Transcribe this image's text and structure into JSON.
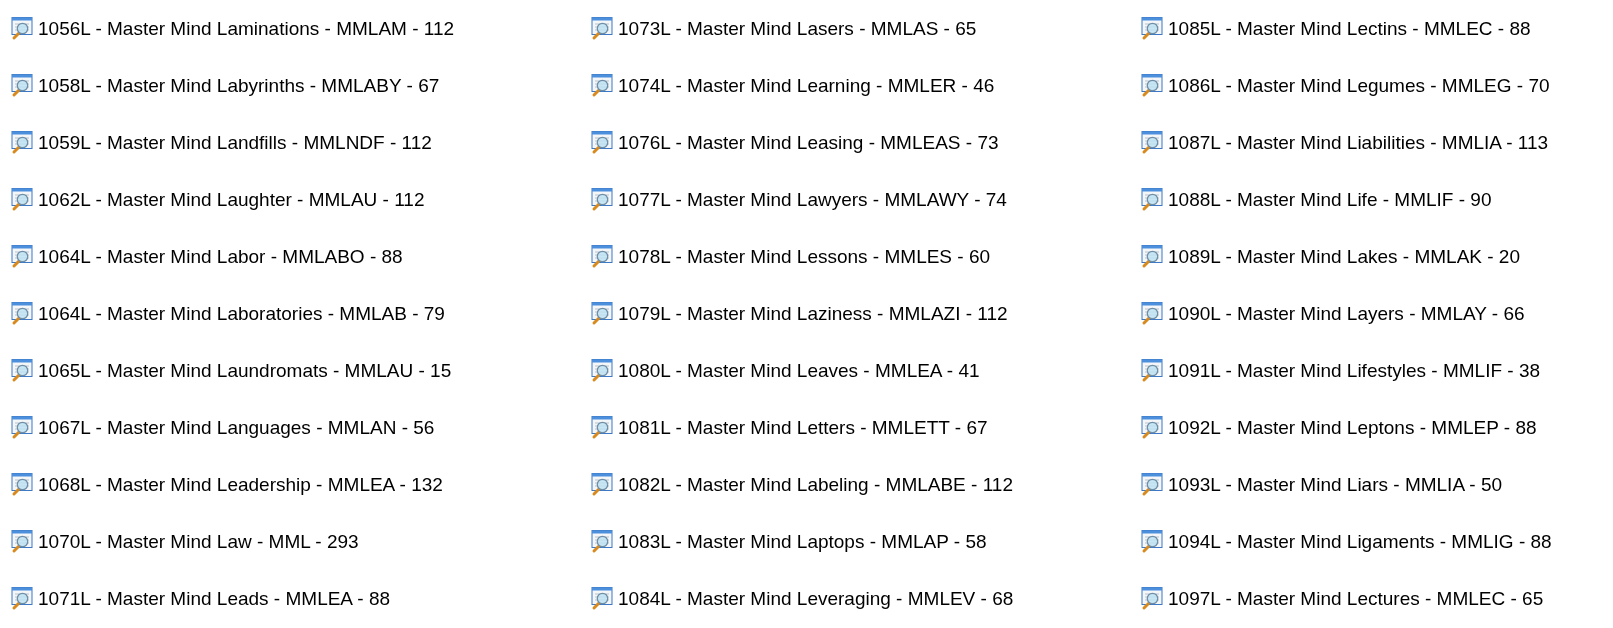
{
  "columns": [
    {
      "files": [
        "1056L - Master Mind Laminations - MMLAM - 112",
        "1058L - Master Mind Labyrinths - MMLABY - 67",
        "1059L - Master Mind Landfills - MMLNDF - 112",
        "1062L - Master Mind Laughter - MMLAU - 112",
        "1064L - Master Mind Labor - MMLABO - 88",
        "1064L - Master Mind Laboratories - MMLAB - 79",
        "1065L - Master Mind Laundromats - MMLAU - 15",
        "1067L - Master Mind Languages - MMLAN - 56",
        "1068L - Master Mind Leadership - MMLEA - 132",
        "1070L - Master Mind Law - MML - 293",
        "1071L - Master Mind Leads - MMLEA - 88"
      ]
    },
    {
      "files": [
        "1073L - Master Mind Lasers - MMLAS - 65",
        "1074L - Master Mind Learning - MMLER - 46",
        "1076L - Master Mind Leasing - MMLEAS - 73",
        "1077L - Master Mind Lawyers - MMLAWY - 74",
        "1078L - Master Mind Lessons - MMLES - 60",
        "1079L - Master Mind Laziness - MMLAZI - 112",
        "1080L - Master Mind Leaves - MMLEA - 41",
        "1081L - Master Mind Letters - MMLETT - 67",
        "1082L - Master Mind Labeling - MMLABE - 112",
        "1083L - Master Mind Laptops - MMLAP - 58",
        "1084L - Master Mind Leveraging - MMLEV - 68"
      ]
    },
    {
      "files": [
        "1085L - Master Mind Lectins - MMLEC - 88",
        "1086L - Master Mind Legumes - MMLEG - 70",
        "1087L - Master Mind Liabilities - MMLIA - 113",
        "1088L - Master Mind Life - MMLIF - 90",
        "1089L - Master Mind Lakes - MMLAK - 20",
        "1090L - Master Mind Layers - MMLAY - 66",
        "1091L - Master Mind Lifestyles - MMLIF - 38",
        "1092L - Master Mind Leptons - MMLEP - 88",
        "1093L - Master Mind Liars - MMLIA - 50",
        "1094L - Master Mind Ligaments - MMLIG - 88",
        "1097L - Master Mind Lectures - MMLEC - 65"
      ]
    }
  ]
}
